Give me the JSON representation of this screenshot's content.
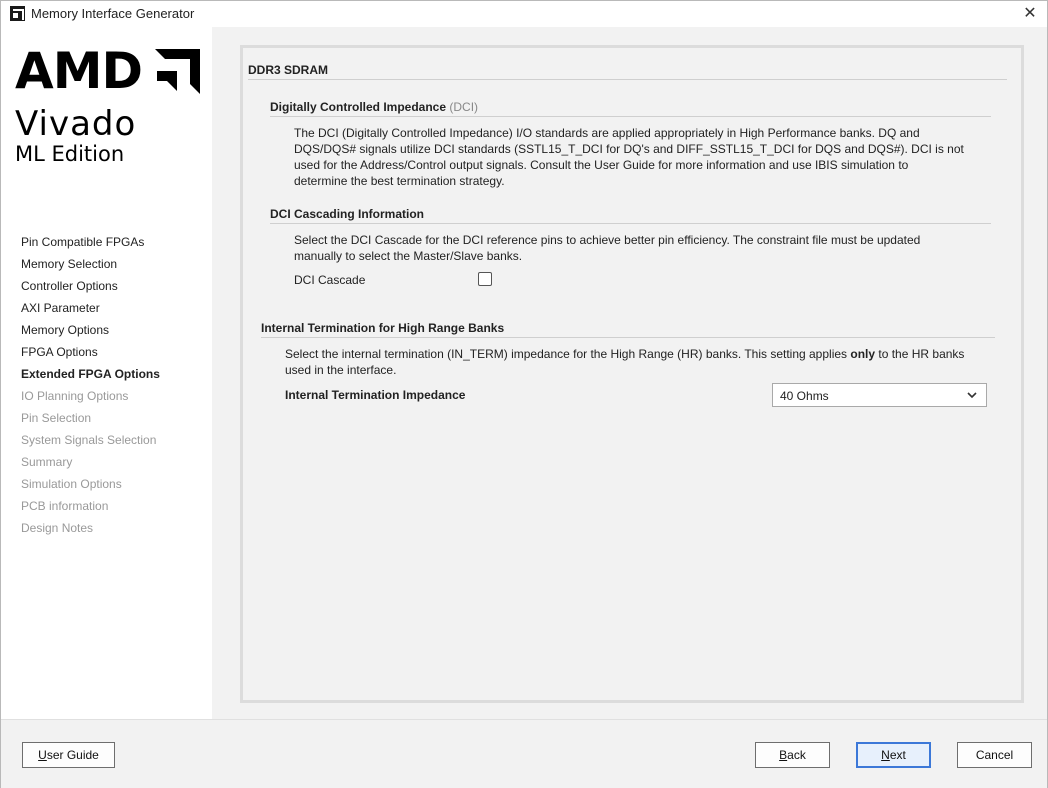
{
  "window": {
    "title": "Memory Interface Generator"
  },
  "logo": {
    "brand": "AMD",
    "product": "Vivado",
    "edition": "ML Edition"
  },
  "sidebar": {
    "items": [
      {
        "label": "Pin Compatible FPGAs",
        "state": "normal"
      },
      {
        "label": "Memory Selection",
        "state": "normal"
      },
      {
        "label": "Controller Options",
        "state": "normal"
      },
      {
        "label": "AXI Parameter",
        "state": "normal"
      },
      {
        "label": "Memory Options",
        "state": "normal"
      },
      {
        "label": "FPGA Options",
        "state": "normal"
      },
      {
        "label": "Extended FPGA Options",
        "state": "active"
      },
      {
        "label": "IO Planning Options",
        "state": "disabled"
      },
      {
        "label": "Pin Selection",
        "state": "disabled"
      },
      {
        "label": "System Signals Selection",
        "state": "disabled"
      },
      {
        "label": "Summary",
        "state": "disabled"
      },
      {
        "label": "Simulation Options",
        "state": "disabled"
      },
      {
        "label": "PCB information",
        "state": "disabled"
      },
      {
        "label": "Design Notes",
        "state": "disabled"
      }
    ]
  },
  "main": {
    "section_title": "DDR3 SDRAM",
    "dci": {
      "heading": "Digitally Controlled Impedance",
      "heading_abbr": "(DCI)",
      "lines": [
        "The DCI (Digitally Controlled Impedance) I/O standards are applied appropriately in High Performance banks. DQ and",
        "DQS/DQS# signals utilize DCI standards (SSTL15_T_DCI for DQ's and DIFF_SSTL15_T_DCI for DQS and DQS#). DCI is not",
        "used for the Address/Control output signals. Consult the User Guide for more information and use IBIS simulation to",
        "determine the best termination strategy."
      ]
    },
    "cascade": {
      "heading": "DCI Cascading Information",
      "lines": [
        "Select the DCI Cascade for the DCI reference pins to achieve better pin efficiency. The constraint file must be updated",
        "manually to select the Master/Slave banks."
      ],
      "checkbox_label": "DCI Cascade",
      "checked": false
    },
    "termination": {
      "heading": "Internal Termination for High Range Banks",
      "line1_prefix": "Select the internal termination (IN_TERM) impedance for the High Range (HR) banks. This setting applies ",
      "line1_bold": "only",
      "line1_suffix": " to the HR banks",
      "line2": "used in the interface.",
      "field_label": "Internal Termination Impedance",
      "selected_value": "40 Ohms"
    }
  },
  "footer": {
    "user_guide": {
      "pre": "",
      "mnemonic": "U",
      "post": "ser Guide"
    },
    "back": {
      "pre": "",
      "mnemonic": "B",
      "post": "ack"
    },
    "next": {
      "pre": "",
      "mnemonic": "N",
      "post": "ext"
    },
    "cancel": "Cancel"
  },
  "colors": {
    "primary_button_border": "#3c78d8",
    "panel_background": "#f2f2f2",
    "disabled_text": "#999999"
  }
}
